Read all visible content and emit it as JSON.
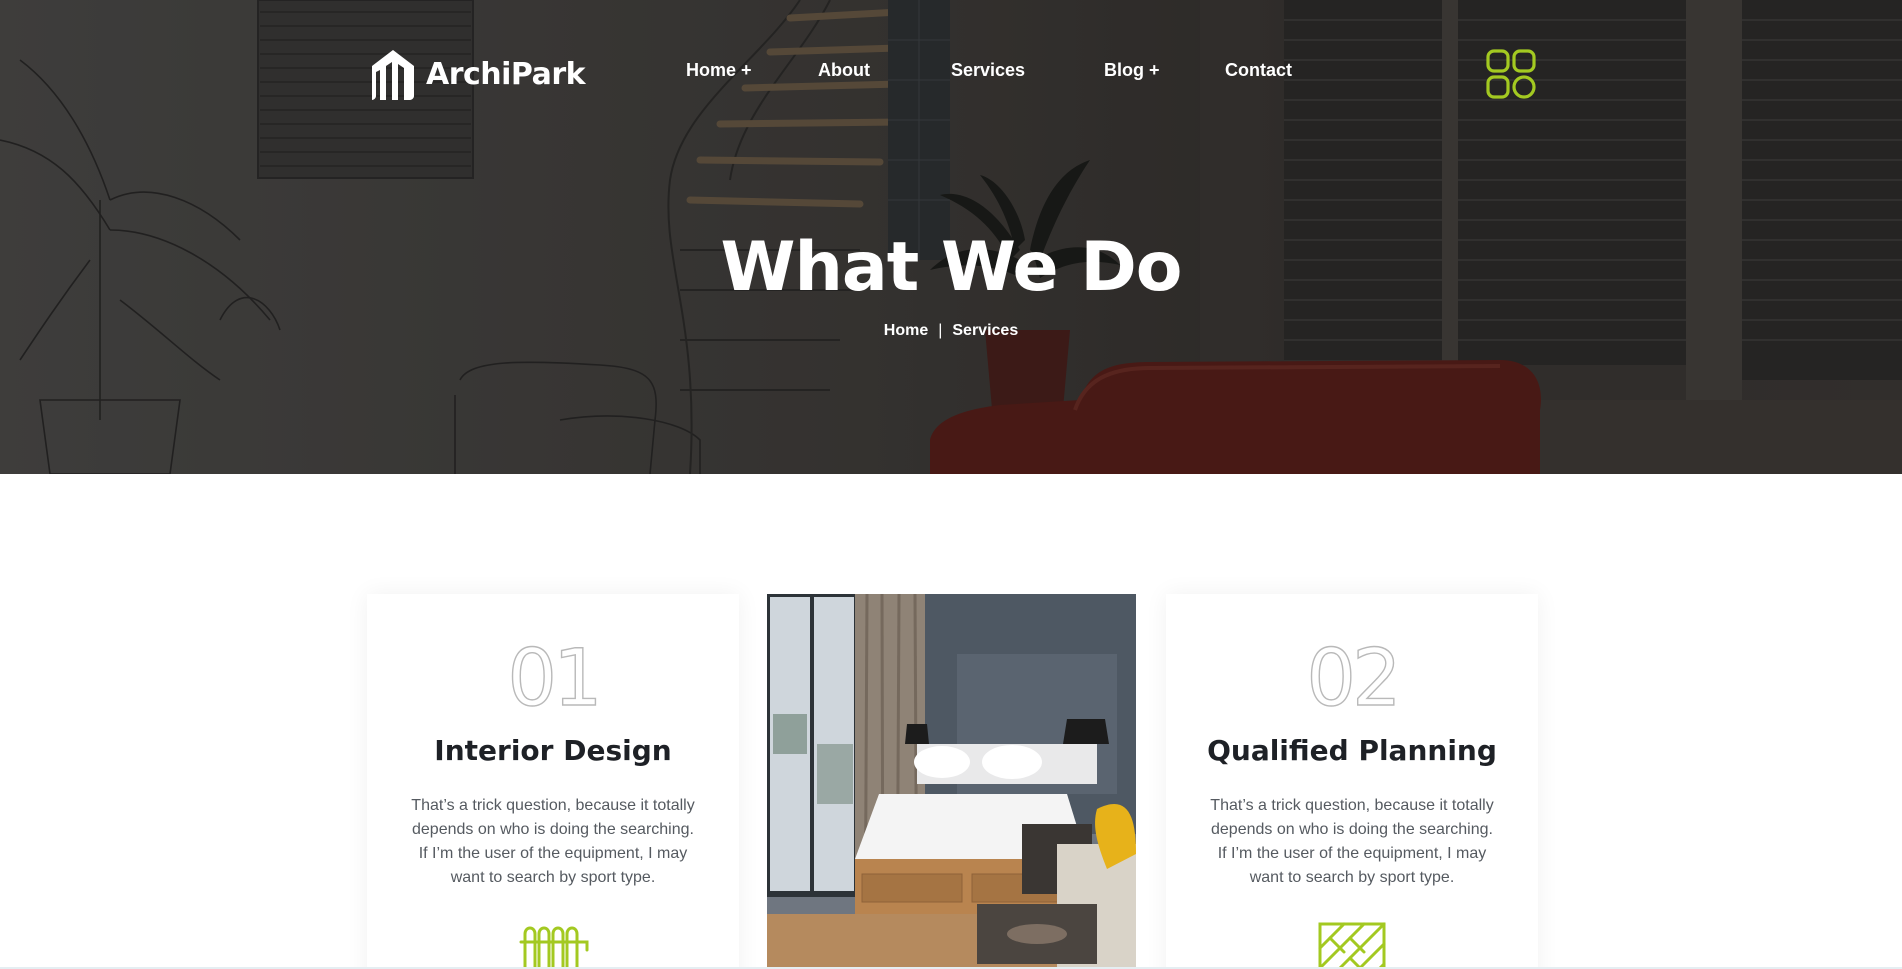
{
  "brand": {
    "name": "ArchiPark",
    "accent": "#a3c921"
  },
  "nav": {
    "items": [
      {
        "label": "Home +"
      },
      {
        "label": "About"
      },
      {
        "label": "Services"
      },
      {
        "label": "Blog +"
      },
      {
        "label": "Contact"
      }
    ],
    "menu_icon": "grid-menu-icon"
  },
  "hero": {
    "title": "What We Do",
    "breadcrumb": {
      "home": "Home",
      "separator": "|",
      "current": "Services"
    }
  },
  "services": [
    {
      "number": "01",
      "title": "Interior Design",
      "description": "That’s a trick question, because it totally depends on who is doing the searching. If I’m the user of the equipment, I may want to search by sport type.",
      "icon": "radiator-icon"
    },
    {
      "number": "02",
      "title": "Qualified Planning",
      "description": "That’s a trick question, because it totally depends on who is doing the searching. If I’m the user of the equipment, I may want to search by sport type.",
      "icon": "parquet-floor-icon"
    }
  ]
}
